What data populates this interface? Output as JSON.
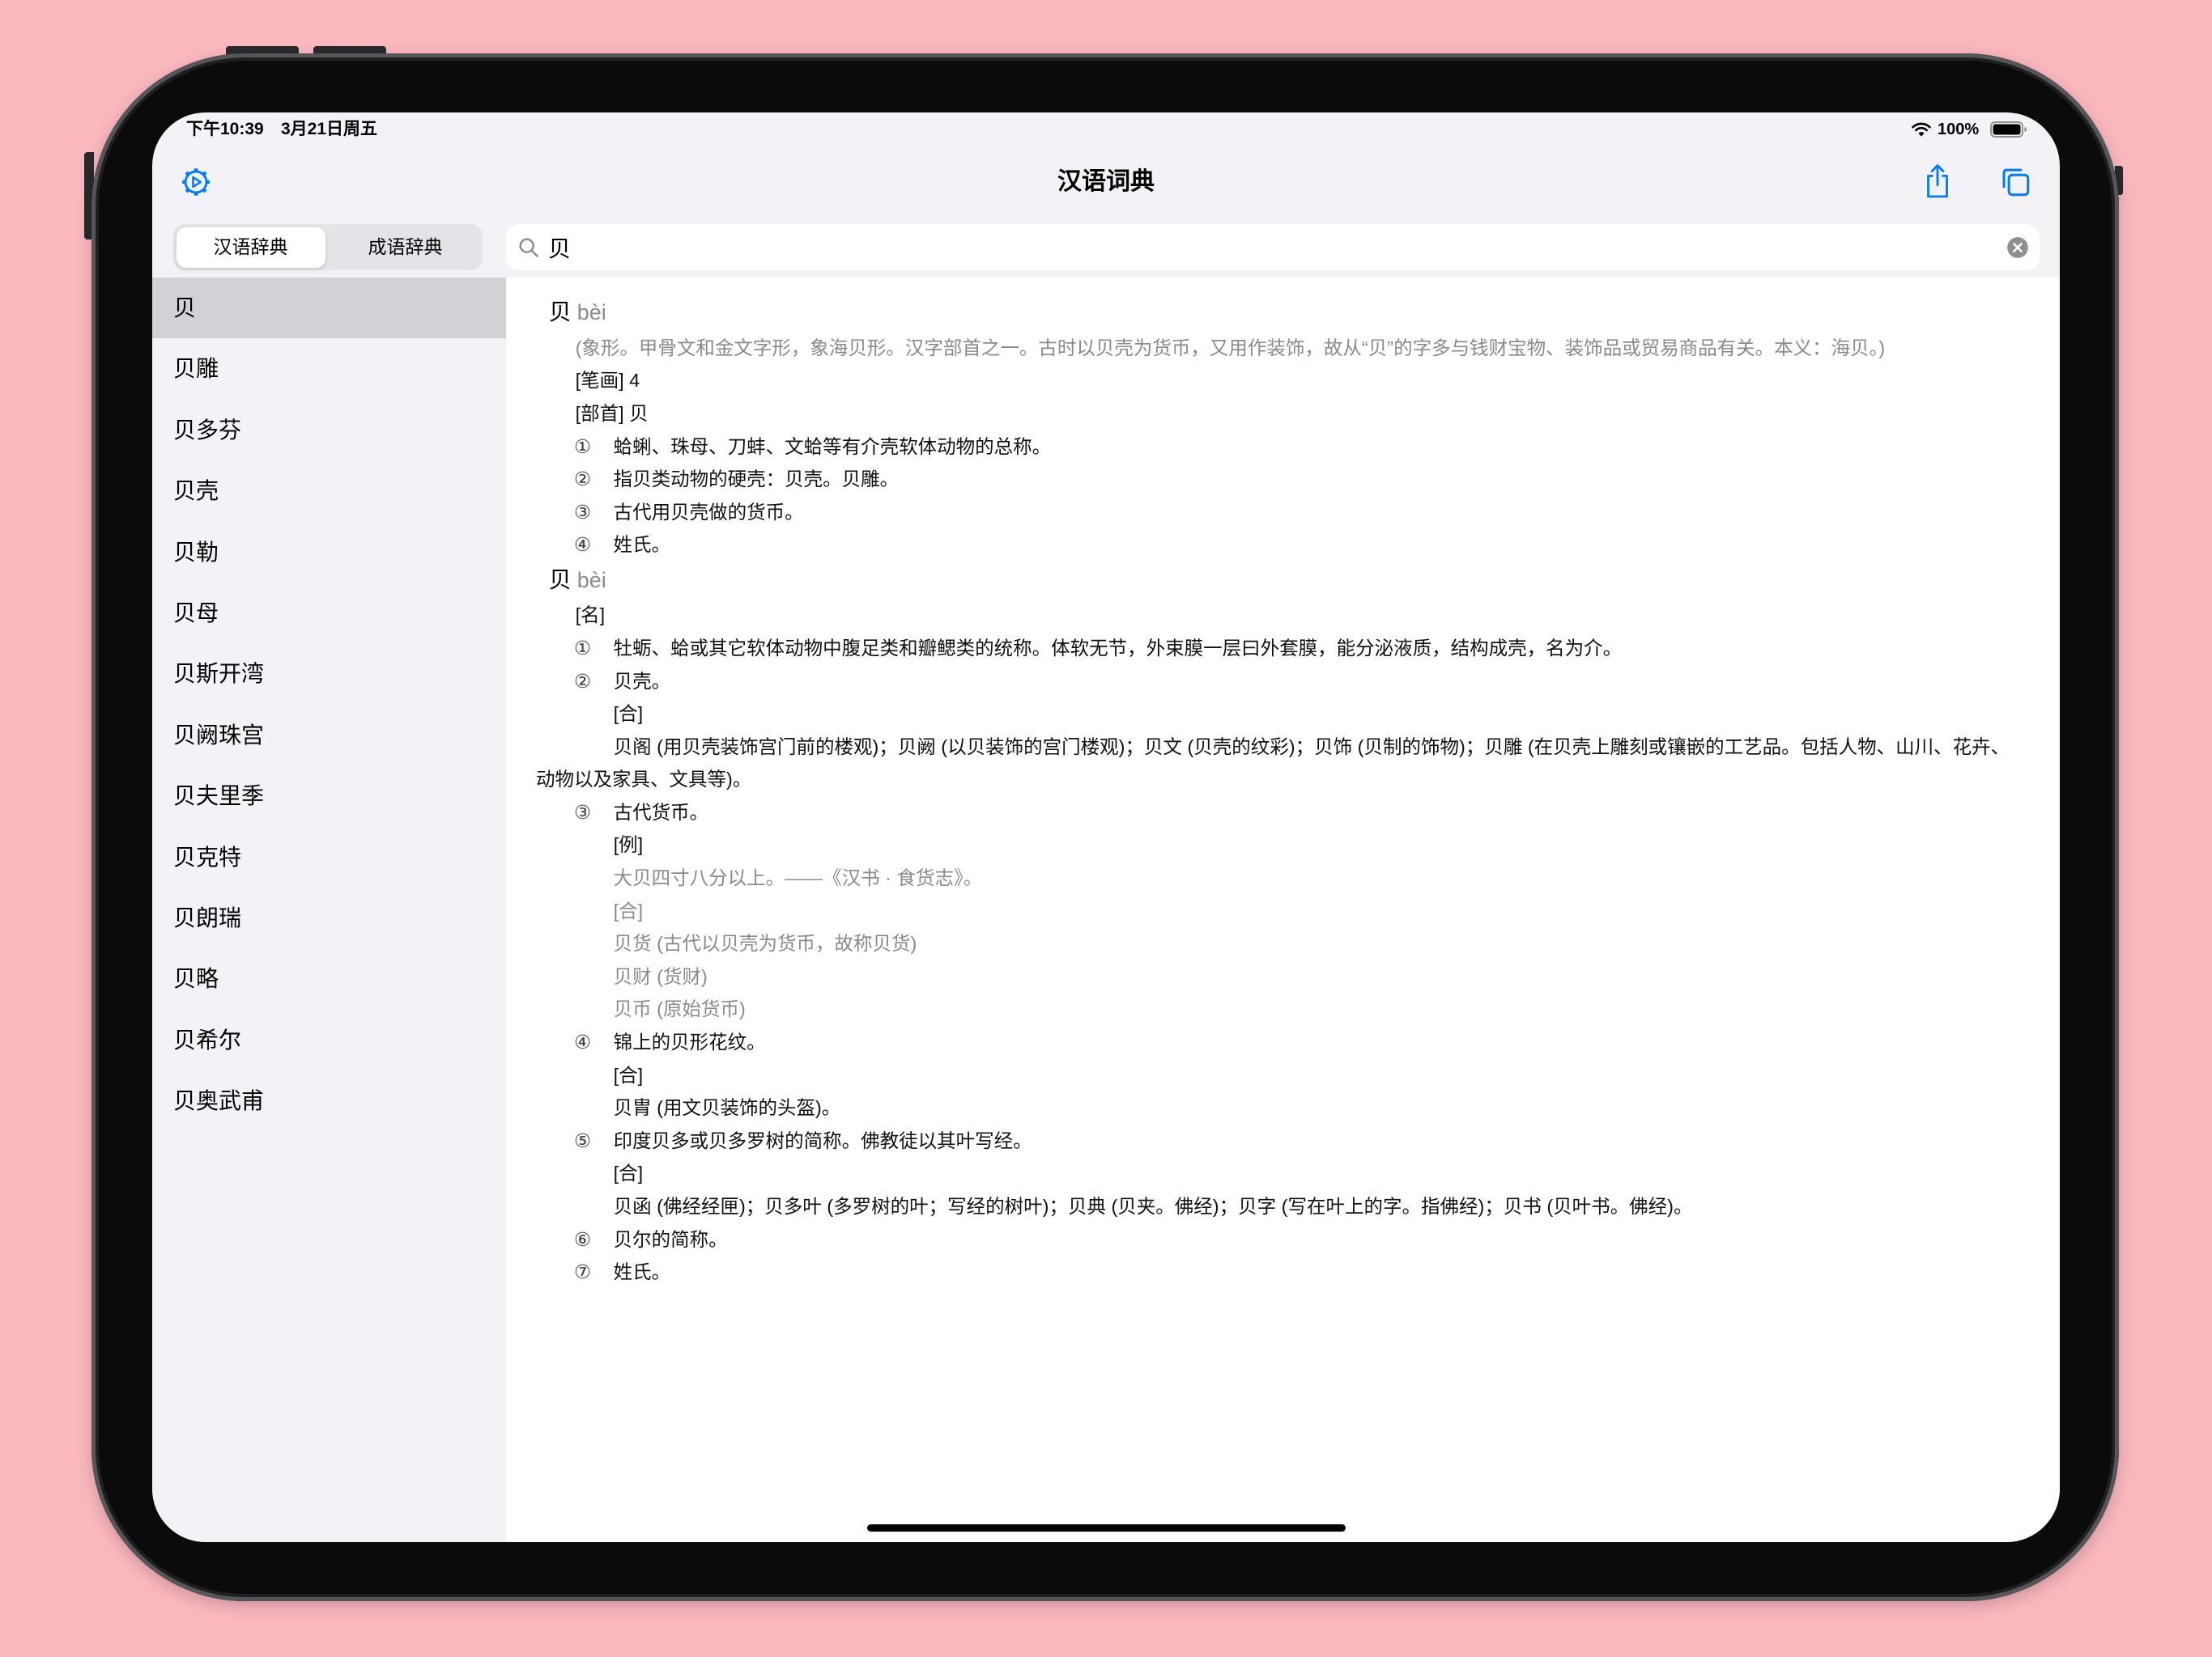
{
  "status_bar": {
    "time": "下午10:39",
    "date": "3月21日周五",
    "battery": "100%",
    "wifi_icon": "wifi-icon",
    "battery_icon": "battery-icon"
  },
  "nav_bar": {
    "title": "汉语词典",
    "settings_icon": "gear-icon",
    "share_icon": "share-icon",
    "copy_icon": "copy-icon"
  },
  "segmented_control": {
    "items": [
      {
        "label": "汉语辞典",
        "selected": true
      },
      {
        "label": "成语辞典",
        "selected": false
      }
    ]
  },
  "search": {
    "value": "贝",
    "search_icon": "magnifier-icon",
    "clear_icon": "clear-icon"
  },
  "sidebar": {
    "selected_index": 0,
    "items": [
      "贝",
      "贝雕",
      "贝多芬",
      "贝壳",
      "贝勒",
      "贝母",
      "贝斯开湾",
      "贝阙珠宫",
      "贝夫里季",
      "贝克特",
      "贝朗瑞",
      "贝略",
      "贝希尔",
      "贝奥武甫"
    ]
  },
  "entries": [
    {
      "headword": "贝",
      "pinyin": "bèi",
      "etymology": "(象形。甲骨文和金文字形，象海贝形。汉字部首之一。古时以贝壳为货币，又用作装饰，故从“贝”的字多与钱财宝物、装饰品或贸易商品有关。本义：海贝。)",
      "strokes": "[笔画] 4",
      "radical": "[部首] 贝",
      "senses": [
        {
          "num": "①",
          "text": "蛤蜊、珠母、刀蚌、文蛤等有介壳软体动物的总称。"
        },
        {
          "num": "②",
          "text": "指贝类动物的硬壳：贝壳。贝雕。"
        },
        {
          "num": "③",
          "text": "古代用贝壳做的货币。"
        },
        {
          "num": "④",
          "text": "姓氏。"
        }
      ]
    },
    {
      "headword": "贝",
      "pinyin": "bèi",
      "part_of_speech": "[名]",
      "senses": [
        {
          "num": "①",
          "text": "牡蛎、蛤或其它软体动物中腹足类和瓣鳃类的统称。体软无节，外束膜一层曰外套膜，能分泌液质，结构成壳，名为介。"
        },
        {
          "num": "②",
          "text": "贝壳。",
          "compound_label": "[合]",
          "compounds": [
            "贝阁 (用贝壳装饰宫门前的楼观)；贝阙 (以贝装饰的宫门楼观)；贝文 (贝壳的纹彩)；贝饰 (贝制的饰物)；贝雕 (在贝壳上雕刻或镶嵌的工艺品。包括人物、山川、花卉、"
          ],
          "compounds_continued": "动物以及家具、文具等)。"
        },
        {
          "num": "③",
          "text": "古代货币。",
          "example_label": "[例]",
          "example": "大贝四寸八分以上。——《汉书 · 食货志》。",
          "compound_label": "[合]",
          "compounds": [
            "贝货 (古代以贝壳为货币，故称贝货)",
            "贝财 (货财)",
            "贝币 (原始货币)"
          ]
        },
        {
          "num": "④",
          "text": "锦上的贝形花纹。",
          "compound_label": "[合]",
          "compounds": [
            "贝胄 (用文贝装饰的头盔)。"
          ]
        },
        {
          "num": "⑤",
          "text": "印度贝多或贝多罗树的简称。佛教徒以其叶写经。",
          "compound_label": "[合]",
          "compounds": [
            "贝函 (佛经经匣)；贝多叶 (多罗树的叶；写经的树叶)；贝典 (贝夹。佛经)；贝字 (写在叶上的字。指佛经)；贝书 (贝叶书。佛经)。"
          ]
        },
        {
          "num": "⑥",
          "text": "贝尔的简称。"
        },
        {
          "num": "⑦",
          "text": "姓氏。"
        }
      ]
    }
  ],
  "colors": {
    "accent": "#007AFF",
    "secondary_text": "#8A8A8E",
    "selected_row": "#D1D1D6",
    "sidebar_background": "#F2F2F7",
    "content_background": "#FFFFFF",
    "backdrop": "#F9B7BE"
  }
}
